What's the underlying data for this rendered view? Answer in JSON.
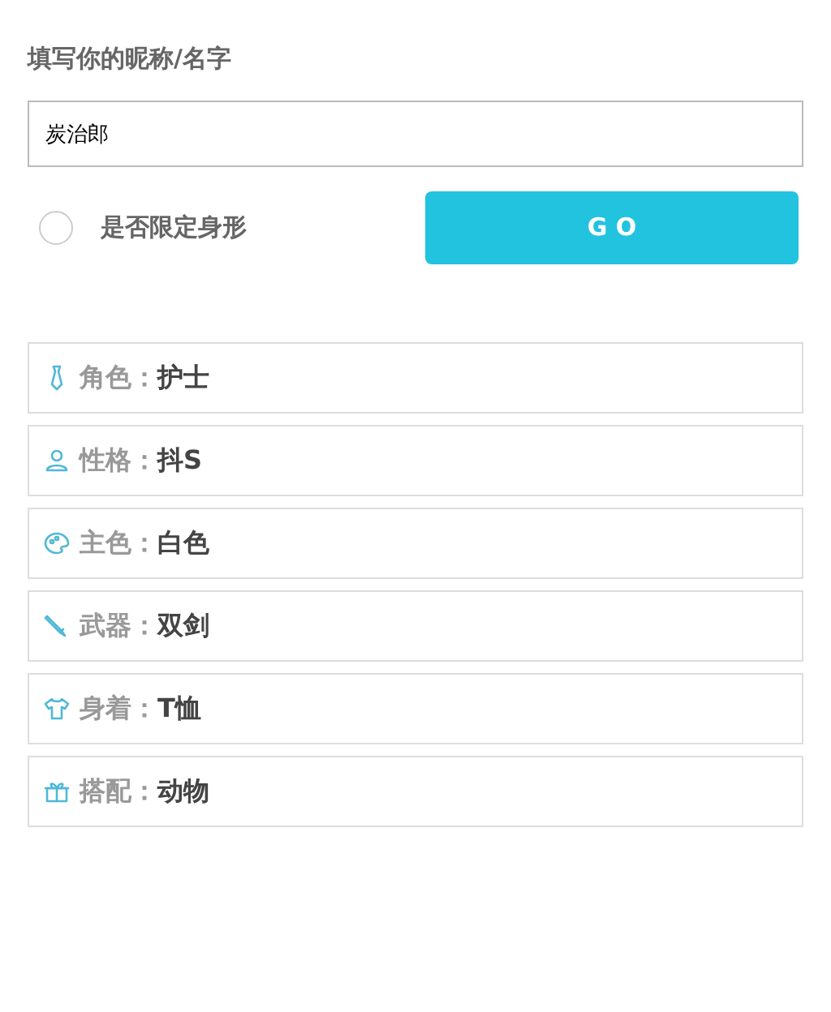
{
  "name_label": "填写你的昵称/名字",
  "name_field": {
    "value": "炭治郎"
  },
  "body_limit": {
    "label": "是否限定身形",
    "checked": false
  },
  "go_button": "G O",
  "attributes": [
    {
      "kind": "tie",
      "label": "角色：",
      "value": "护士"
    },
    {
      "kind": "person",
      "label": "性格：",
      "value": "抖S"
    },
    {
      "kind": "palette",
      "label": "主色：",
      "value": "白色"
    },
    {
      "kind": "pen",
      "label": "武器：",
      "value": "双剑"
    },
    {
      "kind": "shirt",
      "label": "身着：",
      "value": "T恤"
    },
    {
      "kind": "gift",
      "label": "搭配：",
      "value": "动物"
    }
  ]
}
